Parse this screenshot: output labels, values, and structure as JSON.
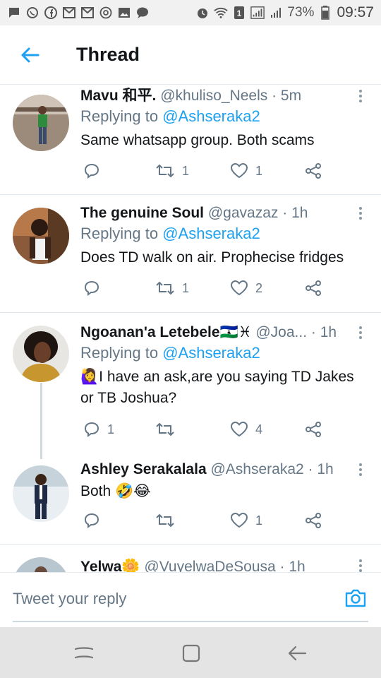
{
  "status_bar": {
    "battery_percent": "73%",
    "time": "09:57",
    "notification_icons": [
      "sms-icon",
      "whatsapp-icon",
      "facebook-icon",
      "gmail-icon",
      "gmail-icon",
      "at-icon",
      "gallery-icon",
      "chat-icon"
    ]
  },
  "header": {
    "title": "Thread"
  },
  "tweets": [
    {
      "name": "Mavu 和平.",
      "handle": "@khuliso_Neels",
      "time": "· 5m",
      "replying_prefix": "Replying to",
      "replying_to": "@Ashseraka2",
      "text": "Same whatsapp group. Both scams",
      "comments": "",
      "retweets": "1",
      "likes": "1"
    },
    {
      "name": "The genuine Soul",
      "handle": "@gavazaz",
      "time": "· 1h",
      "replying_prefix": "Replying to",
      "replying_to": "@Ashseraka2",
      "text": "Does TD walk on air. Prophecise fridges",
      "comments": "",
      "retweets": "1",
      "likes": "2"
    },
    {
      "name": "Ngoanan'a Letebele🇱🇸♓",
      "handle": "@Joa...",
      "time": "· 1h",
      "replying_prefix": "Replying to",
      "replying_to": "@Ashseraka2",
      "text": "🙋‍♀️I have an ask,are you saying TD Jakes or TB Joshua?",
      "comments": "1",
      "retweets": "",
      "likes": "4"
    },
    {
      "name": "Ashley Serakalala",
      "handle": "@Ashseraka2",
      "time": "· 1h",
      "text": "Both 🤣😂",
      "comments": "",
      "retweets": "",
      "likes": "1"
    },
    {
      "name": "Yelwa🌼",
      "handle": "@VuyelwaDeSousa",
      "time": "· 1h"
    }
  ],
  "reply_bar": {
    "placeholder": "Tweet your reply"
  },
  "colors": {
    "accent": "#1da1f2",
    "secondary_text": "#657786",
    "divider": "#e1e8ed"
  }
}
